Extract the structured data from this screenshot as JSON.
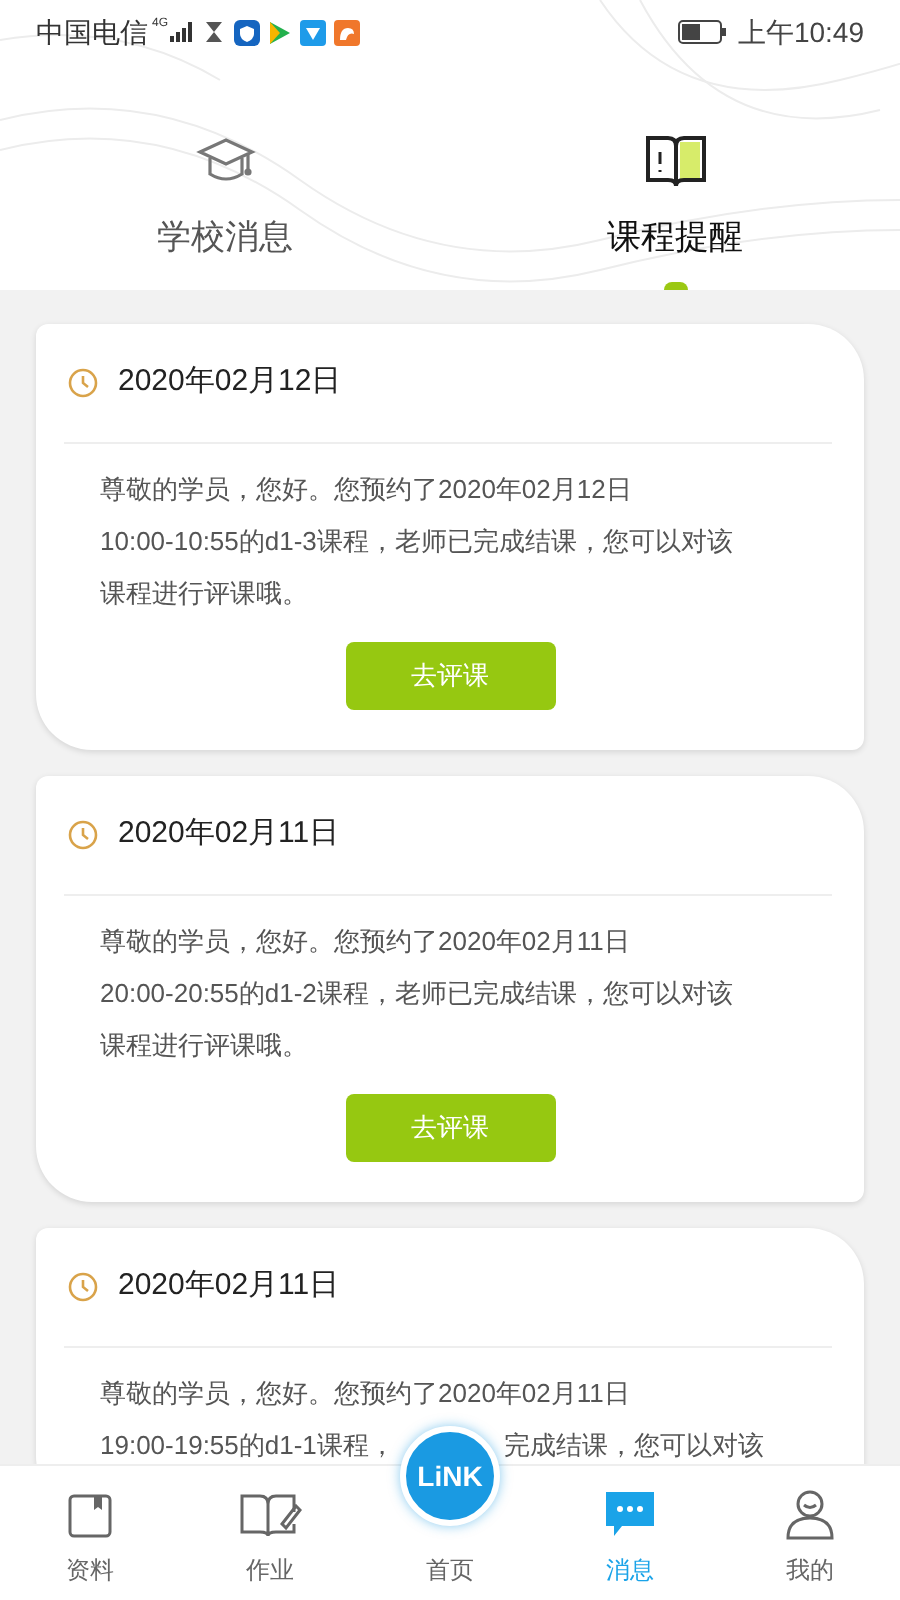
{
  "status_bar": {
    "carrier": "中国电信",
    "network": "4G",
    "time": "上午10:49"
  },
  "tabs": [
    {
      "label": "学校消息",
      "selected": false,
      "kind": "school"
    },
    {
      "label": "课程提醒",
      "selected": true,
      "kind": "course"
    }
  ],
  "cards": [
    {
      "date": "2020年02月12日",
      "lines": [
        "尊敬的学员，您好。您预约了2020年02月12日",
        "10:00-10:55的d1-3课程，老师已完成结课，您可以对该",
        "课程进行评课哦。"
      ],
      "button": "去评课"
    },
    {
      "date": "2020年02月11日",
      "lines": [
        "尊敬的学员，您好。您预约了2020年02月11日",
        "20:00-20:55的d1-2课程，老师已完成结课，您可以对该",
        "课程进行评课哦。"
      ],
      "button": "去评课"
    },
    {
      "date": "2020年02月11日",
      "lines": [
        "尊敬的学员，您好。您预约了2020年02月11日"
      ],
      "covered_line": [
        "19:00-19:55的d1-1课程，",
        "完成结课，您可以对该"
      ]
    }
  ],
  "nav": [
    {
      "label": "资料",
      "kind": "material",
      "selected": false
    },
    {
      "label": "作业",
      "kind": "homework",
      "selected": false
    },
    {
      "label": "首页",
      "kind": "home",
      "selected": false,
      "badge": "LiNK"
    },
    {
      "label": "消息",
      "kind": "message",
      "selected": true
    },
    {
      "label": "我的",
      "kind": "me",
      "selected": false
    }
  ]
}
